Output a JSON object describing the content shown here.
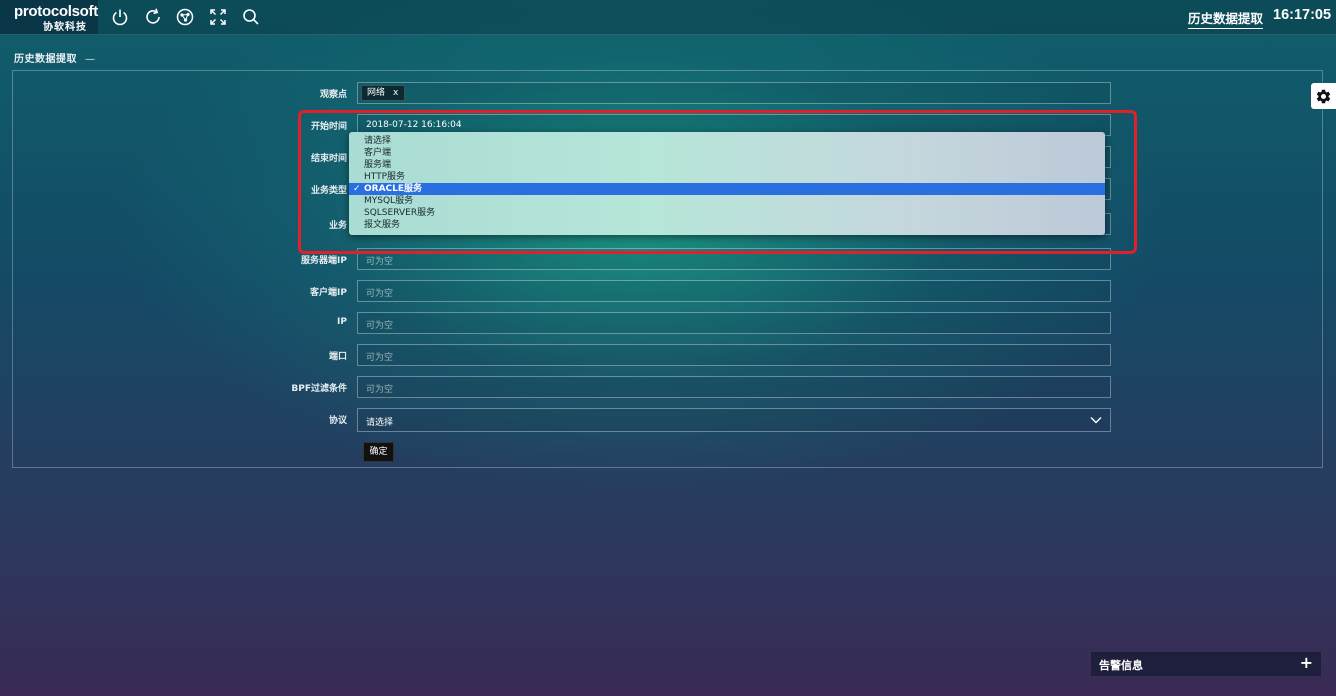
{
  "header": {
    "logo_en": "protocolsoft",
    "logo_cn": "协软科技",
    "icons": [
      "power-icon",
      "refresh-icon",
      "network-icon",
      "fullscreen-icon",
      "search-icon"
    ],
    "page_link": "历史数据提取",
    "clock": "16:17:05"
  },
  "panel": {
    "title": "历史数据提取",
    "collapse": "—"
  },
  "form": {
    "observe_point": {
      "label": "观察点",
      "tag": "网络",
      "tag_remove": "x"
    },
    "start_time": {
      "label": "开始时间",
      "value": "2018-07-12 16:16:04"
    },
    "end_time": {
      "label": "结束时间"
    },
    "service_type": {
      "label": "业务类型"
    },
    "service": {
      "label": "业务"
    },
    "server_ip": {
      "label": "服务器端IP",
      "placeholder": "可为空"
    },
    "client_ip": {
      "label": "客户端IP",
      "placeholder": "可为空"
    },
    "ip": {
      "label": "IP",
      "placeholder": "可为空"
    },
    "port": {
      "label": "端口",
      "placeholder": "可为空"
    },
    "bpf": {
      "label": "BPF过滤条件",
      "placeholder": "可为空"
    },
    "protocol": {
      "label": "协议",
      "value": "请选择"
    },
    "submit": "确定"
  },
  "dropdown": {
    "options": [
      "请选择",
      "客户端",
      "服务端",
      "HTTP服务",
      "ORACLE服务",
      "MYSQL服务",
      "SQLSERVER服务",
      "报文服务"
    ],
    "selected_index": 4,
    "check": "✓"
  },
  "alarm": {
    "title": "告警信息",
    "toggle": "+"
  },
  "colors": {
    "selection": "#2a6fe0",
    "highlight_border": "#e0202a"
  }
}
